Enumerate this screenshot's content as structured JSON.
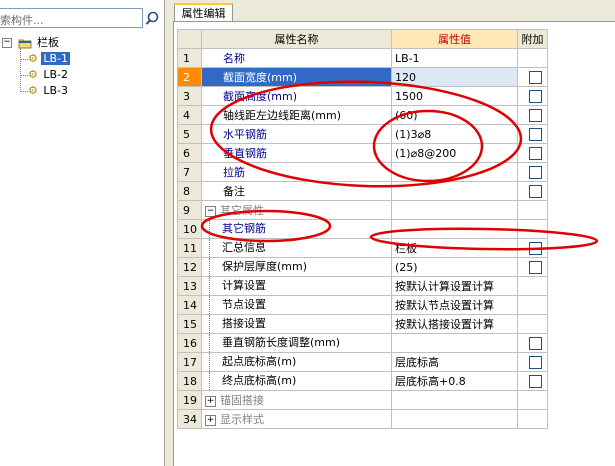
{
  "left_panel": {
    "search_placeholder": "索构件...",
    "tree_root_label": "栏板",
    "tree_items": [
      "LB-1",
      "LB-2",
      "LB-3"
    ]
  },
  "tab": {
    "label": "属性编辑"
  },
  "grid": {
    "headers": {
      "name": "属性名称",
      "value": "属性值",
      "extra": "附加"
    },
    "rows": [
      {
        "num": "1",
        "name": "名称",
        "value": "LB-1",
        "check": false,
        "style": "blue"
      },
      {
        "num": "2",
        "name": "截面宽度(mm)",
        "value": "120",
        "check": true,
        "style": "blue",
        "selected": true
      },
      {
        "num": "3",
        "name": "截面高度(mm)",
        "value": "1500",
        "check": true,
        "style": "blue"
      },
      {
        "num": "4",
        "name": "轴线距左边线距离(mm)",
        "value": "(60)",
        "check": true,
        "style": "black"
      },
      {
        "num": "5",
        "name": "水平钢筋",
        "value": "(1)3⌀8",
        "check": true,
        "style": "blue"
      },
      {
        "num": "6",
        "name": "垂直钢筋",
        "value": "(1)⌀8@200",
        "check": true,
        "style": "blue"
      },
      {
        "num": "7",
        "name": "拉筋",
        "value": "",
        "check": true,
        "style": "blue"
      },
      {
        "num": "8",
        "name": "备注",
        "value": "",
        "check": true,
        "style": "black"
      },
      {
        "num": "9",
        "name": "其它属性",
        "value": "",
        "check": false,
        "style": "gray",
        "expander": "−"
      },
      {
        "num": "10",
        "name": "其它钢筋",
        "value": "",
        "check": false,
        "style": "blue",
        "tree": true
      },
      {
        "num": "11",
        "name": "汇总信息",
        "value": "栏板",
        "check": true,
        "style": "black",
        "tree": true
      },
      {
        "num": "12",
        "name": "保护层厚度(mm)",
        "value": "(25)",
        "check": true,
        "style": "black",
        "tree": true
      },
      {
        "num": "13",
        "name": "计算设置",
        "value": "按默认计算设置计算",
        "check": false,
        "style": "black",
        "tree": true
      },
      {
        "num": "14",
        "name": "节点设置",
        "value": "按默认节点设置计算",
        "check": false,
        "style": "black",
        "tree": true
      },
      {
        "num": "15",
        "name": "搭接设置",
        "value": "按默认搭接设置计算",
        "check": false,
        "style": "black",
        "tree": true
      },
      {
        "num": "16",
        "name": "垂直钢筋长度调整(mm)",
        "value": "",
        "check": true,
        "style": "black",
        "tree": true
      },
      {
        "num": "17",
        "name": "起点底标高(m)",
        "value": "层底标高",
        "check": true,
        "style": "black",
        "tree": true
      },
      {
        "num": "18",
        "name": "终点底标高(m)",
        "value": "层底标高+0.8",
        "check": true,
        "style": "black",
        "tree": true
      },
      {
        "num": "19",
        "name": "锚固搭接",
        "value": "",
        "check": false,
        "style": "gray",
        "expander": "+"
      },
      {
        "num": "34",
        "name": "显示样式",
        "value": "",
        "check": false,
        "style": "gray",
        "expander": "+"
      }
    ]
  },
  "colors": {
    "annotation_red": "#e00000",
    "selection_blue": "#316ac5",
    "row_marker_orange": "#ff8c00"
  }
}
